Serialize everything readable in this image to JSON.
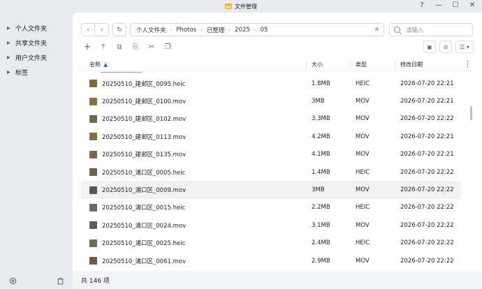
{
  "window": {
    "title": "文件管理",
    "controls": [
      "?",
      "—",
      "☐",
      "✕"
    ]
  },
  "sidebar": {
    "items": [
      {
        "label": "个人文件夹",
        "icon": "chevron-right-icon"
      },
      {
        "label": "共享文件夹",
        "icon": "chevron-right-icon"
      },
      {
        "label": "用户文件夹",
        "icon": "chevron-right-icon"
      },
      {
        "label": "标签",
        "icon": "chevron-right-icon"
      }
    ],
    "bottom_icons": [
      "settings-icon",
      "trash-icon"
    ]
  },
  "navigation": {
    "back_icon": "‹",
    "forward_icon": "›",
    "refresh_icon": "↻",
    "breadcrumb": [
      "个人文件夹",
      "Photos",
      "已整理",
      "2025",
      "05"
    ],
    "star_icon": "★"
  },
  "search": {
    "placeholder": "请输入"
  },
  "toolbar": {
    "left": [
      "+",
      "⤒",
      "⧉",
      "⎘",
      "✂",
      "❐"
    ],
    "right": [
      "▣",
      "⊘",
      "⊞"
    ],
    "view_label": "☰ ▾"
  },
  "columns": {
    "name": "名称",
    "sort_arrow": "▲",
    "size": "大小",
    "type": "类型",
    "date": "修改日期",
    "more": "⋮"
  },
  "files": [
    {
      "name": "20250510_建邺区_0095.heic",
      "size": "1.8MB",
      "type": "HEIC",
      "date": "2026-07-20 22:21",
      "thumb": "#7a6a40"
    },
    {
      "name": "20250510_建邺区_0100.mov",
      "size": "3MB",
      "type": "MOV",
      "date": "2026-07-20 22:21",
      "thumb": "#8a7340"
    },
    {
      "name": "20250510_建邺区_0102.mov",
      "size": "3.3MB",
      "type": "MOV",
      "date": "2026-07-20 22:22",
      "thumb": "#6d6846"
    },
    {
      "name": "20250510_建邺区_0113.mov",
      "size": "4.2MB",
      "type": "MOV",
      "date": "2026-07-20 22:21",
      "thumb": "#8b6d3a"
    },
    {
      "name": "20250510_建邺区_0135.mov",
      "size": "4.1MB",
      "type": "MOV",
      "date": "2026-07-20 22:21",
      "thumb": "#7b6a48"
    },
    {
      "name": "20250510_浦口区_0005.heic",
      "size": "1.4MB",
      "type": "HEIC",
      "date": "2026-07-20 22:22",
      "thumb": "#6e6250"
    },
    {
      "name": "20250510_浦口区_0009.mov",
      "size": "3MB",
      "type": "MOV",
      "date": "2026-07-20 22:22",
      "thumb": "#5f574a"
    },
    {
      "name": "20250510_浦口区_0015.heic",
      "size": "2.2MB",
      "type": "HEIC",
      "date": "2026-07-20 22:22",
      "thumb": "#676a6a"
    },
    {
      "name": "20250510_浦口区_0024.mov",
      "size": "3.1MB",
      "type": "MOV",
      "date": "2026-07-20 22:22",
      "thumb": "#5a5f62"
    },
    {
      "name": "20250510_浦口区_0025.heic",
      "size": "2.4MB",
      "type": "HEIC",
      "date": "2026-07-20 22:22",
      "thumb": "#736a58"
    },
    {
      "name": "20250510_浦口区_0061.mov",
      "size": "2.9MB",
      "type": "MOV",
      "date": "2026-07-20 22:22",
      "thumb": "#6b5a46"
    }
  ],
  "selected_row": 6,
  "status": {
    "count_text": "共 146 项"
  }
}
